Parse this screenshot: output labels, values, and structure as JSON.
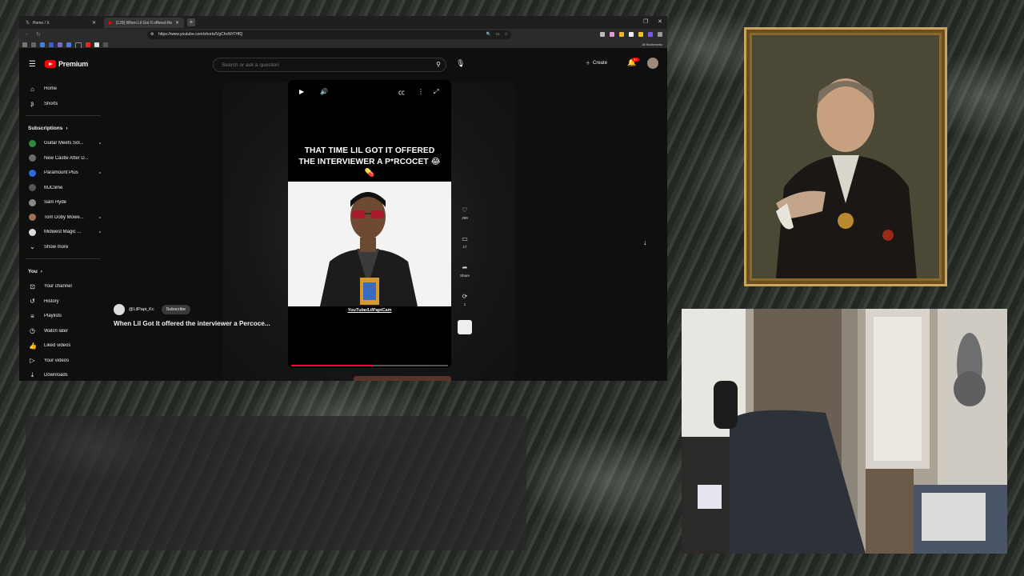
{
  "browser": {
    "tabs": [
      {
        "label": "Home / X",
        "icon": "x-logo"
      },
      {
        "label": "(129) When Lil Got It offered the...",
        "icon": "youtube-logo"
      }
    ],
    "new_tab": "+",
    "url": "https://www.youtube.com/shorts/VgChxWrTHfQ",
    "all_bookmarks": "All Bookmarks"
  },
  "youtube": {
    "logo_text": "Premium",
    "search_placeholder": "Search or ask a question",
    "create_label": "Create",
    "notif_count": "9+",
    "sidebar": {
      "top": [
        {
          "label": "Home",
          "icon": "home-icon"
        },
        {
          "label": "Shorts",
          "icon": "shorts-icon"
        }
      ],
      "subscriptions_header": "Subscriptions",
      "subscriptions": [
        {
          "label": "Guitar Meets Sol...",
          "color": "#2e8b3a"
        },
        {
          "label": "New Castle After D...",
          "color": "#6b6b6b"
        },
        {
          "label": "Paramount Plus",
          "color": "#2b6be0"
        },
        {
          "label": "MJClime",
          "color": "#555555"
        },
        {
          "label": "Sam Hyde",
          "color": "#8a8a8a"
        },
        {
          "label": "Tom Doby Mowe...",
          "color": "#a07050"
        },
        {
          "label": "Midwest Magic ...",
          "color": "#dddddd"
        }
      ],
      "show_more": "Show more",
      "you_header": "You",
      "you": [
        {
          "label": "Your channel",
          "icon": "user-box-icon"
        },
        {
          "label": "History",
          "icon": "history-icon"
        },
        {
          "label": "Playlists",
          "icon": "playlist-icon"
        },
        {
          "label": "Watch later",
          "icon": "clock-icon"
        },
        {
          "label": "Liked videos",
          "icon": "thumb-up-icon"
        },
        {
          "label": "Your videos",
          "icon": "video-icon"
        },
        {
          "label": "Downloads",
          "icon": "download-icon"
        }
      ]
    },
    "short": {
      "caption": "THAT TIME LIL GOT IT OFFERED THE INTERVIEWER A P*RCOCET 😂💊",
      "watermark": "YouTube/LilPapiCam",
      "channel": "@LilPapi_Kc",
      "subscribe": "Subscribe",
      "title": "When Lil Got It offered the interviewer a Percoce...",
      "progress": 0.52,
      "likes": "299",
      "comments": "17",
      "share": "Share",
      "remix": "1"
    }
  }
}
